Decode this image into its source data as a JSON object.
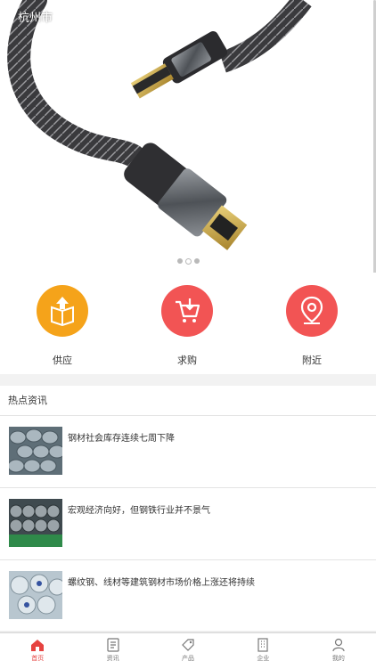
{
  "header": {
    "city": "杭州市"
  },
  "banner": {
    "slides": 3,
    "active_slide": 2
  },
  "quick_links": [
    {
      "label": "供应",
      "color": "#f5a31a",
      "icon": "supply-box-icon"
    },
    {
      "label": "求购",
      "color": "#f25454",
      "icon": "purchase-cart-icon"
    },
    {
      "label": "附近",
      "color": "#f25454",
      "icon": "location-pin-icon"
    }
  ],
  "news": {
    "title": "热点资讯",
    "items": [
      {
        "title": "钢材社会库存连续七周下降"
      },
      {
        "title": "宏观经济向好，但钢铁行业并不景气"
      },
      {
        "title": "螺纹钢、线材等建筑钢材市场价格上涨还将持续"
      }
    ]
  },
  "tabbar": [
    {
      "label": "首页",
      "icon": "home-icon",
      "active": true
    },
    {
      "label": "资讯",
      "icon": "news-icon",
      "active": false
    },
    {
      "label": "产品",
      "icon": "tag-icon",
      "active": false
    },
    {
      "label": "企业",
      "icon": "building-icon",
      "active": false
    },
    {
      "label": "我的",
      "icon": "user-icon",
      "active": false
    }
  ],
  "colors": {
    "accent": "#e64340",
    "supply": "#f5a31a",
    "red": "#f25454"
  }
}
